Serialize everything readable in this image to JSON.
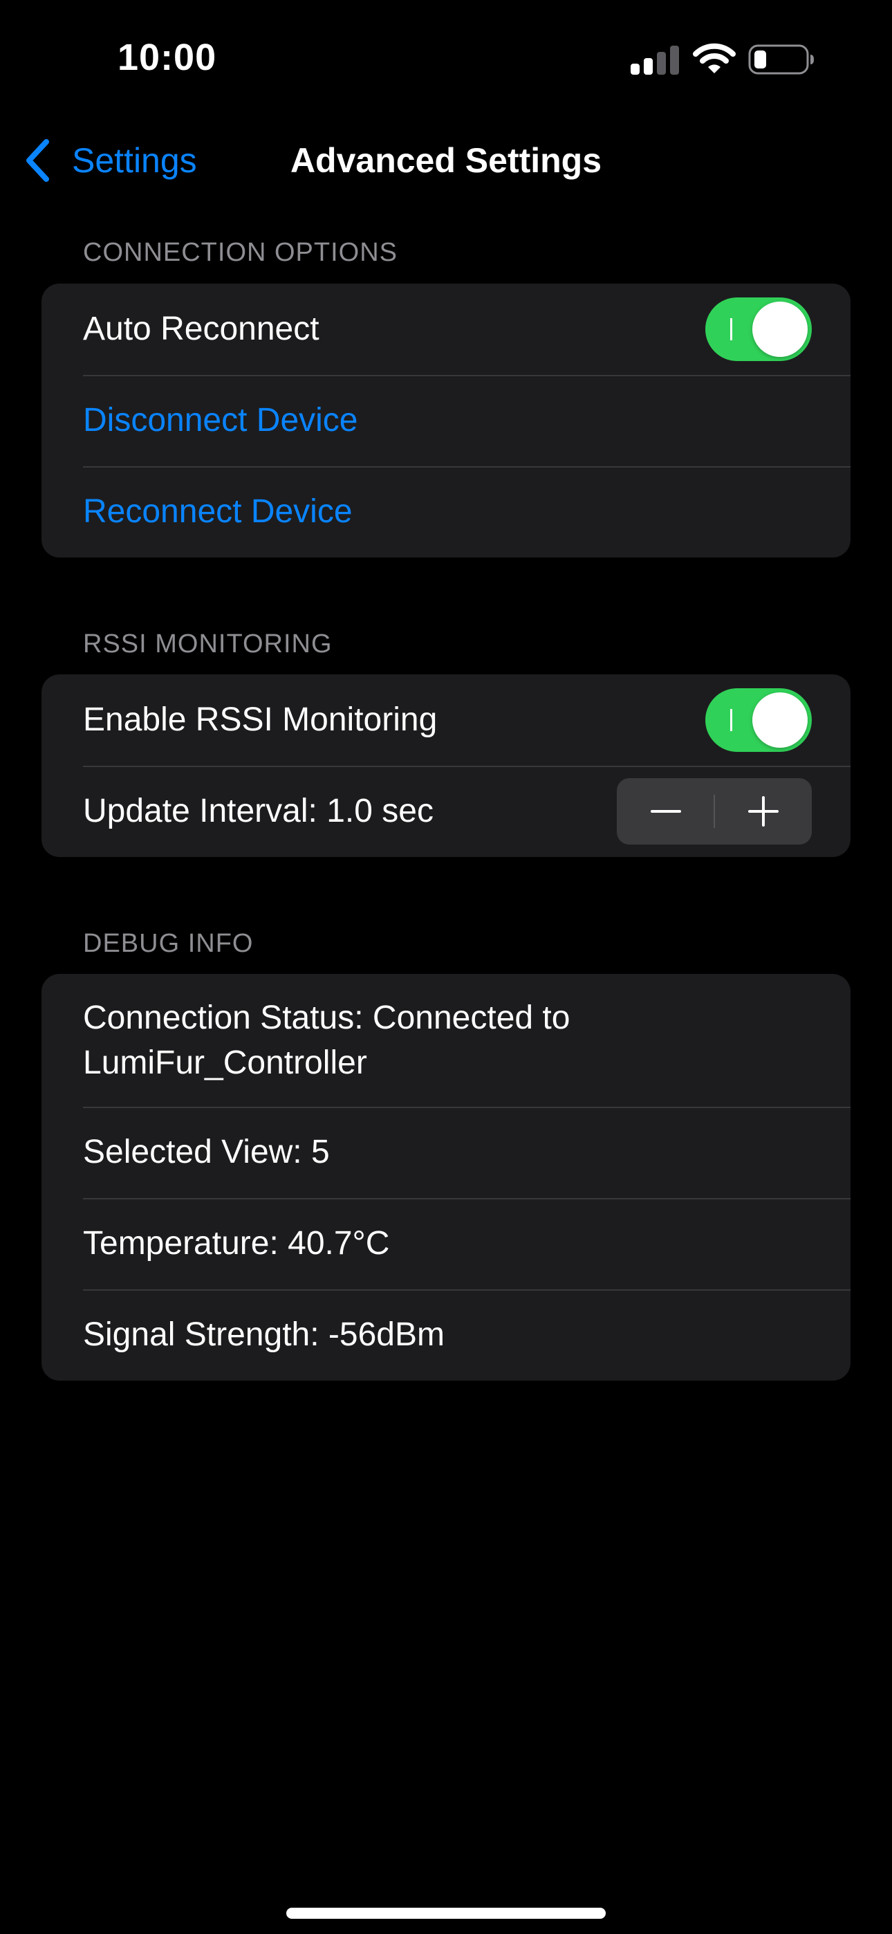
{
  "status_bar": {
    "time": "10:00",
    "signal_icon": "cellular-signal-icon",
    "wifi_icon": "wifi-icon",
    "battery_icon": "battery-icon"
  },
  "nav": {
    "back_label": "Settings",
    "title": "Advanced Settings"
  },
  "sections": {
    "connection_options": {
      "header": "CONNECTION OPTIONS",
      "auto_reconnect_label": "Auto Reconnect",
      "auto_reconnect_on": true,
      "disconnect_label": "Disconnect Device",
      "reconnect_label": "Reconnect Device"
    },
    "rssi_monitoring": {
      "header": "RSSI MONITORING",
      "enable_label": "Enable RSSI Monitoring",
      "enable_on": true,
      "update_interval_label": "Update Interval: 1.0 sec"
    },
    "debug_info": {
      "header": "DEBUG INFO",
      "connection_status": "Connection Status: Connected to LumiFur_Controller",
      "selected_view": "Selected View: 5",
      "temperature": "Temperature: 40.7°C",
      "signal_strength": "Signal Strength: -56dBm"
    }
  },
  "colors": {
    "background": "#000000",
    "group_background": "#1c1c1e",
    "accent": "#0a84ff",
    "toggle_on": "#30d158",
    "secondary_text": "#8e8e93"
  }
}
